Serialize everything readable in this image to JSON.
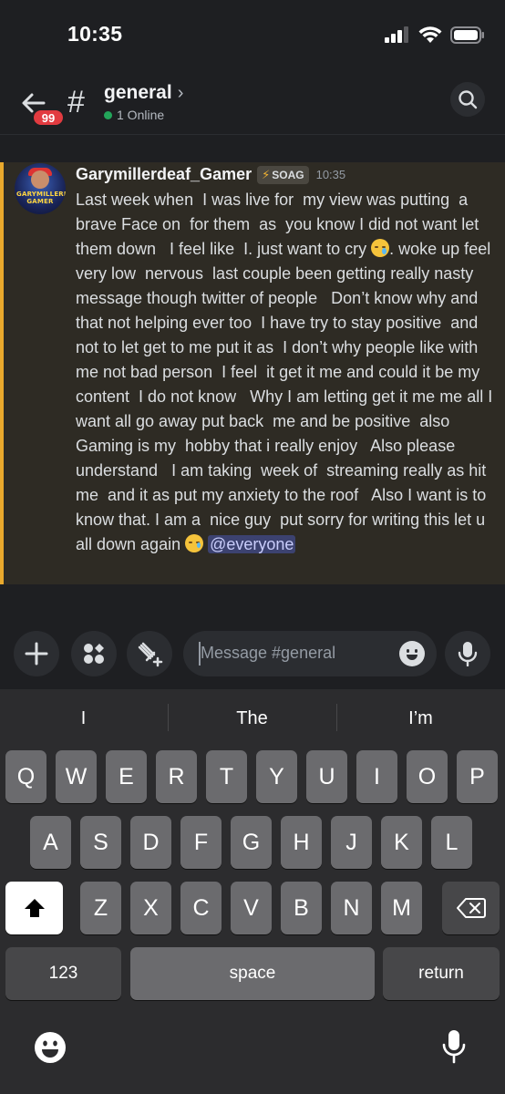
{
  "status_bar": {
    "time": "10:35"
  },
  "header": {
    "notification_count": "99",
    "channel_name": "general",
    "channel_chevron": "›",
    "online_text": "1 Online"
  },
  "message": {
    "avatar_text": "GARYMILLERDEAF GAMER",
    "username": "Garymillerdeaf_Gamer",
    "role_tag": "SOAG",
    "timestamp": "10:35",
    "text_main": "Last week when  I was live for  my view was putting  a  brave Face on  for them  as  you know I did not want let  them down   I feel like  I. just want to cry ",
    "text_mid": ". woke up feel very low  nervous  last couple been getting really nasty message though twitter of people   Don’t know why and that not helping ever too  I have try to stay positive  and not to let get to me put it as  I don’t why people like with me not bad person  I feel  it get it me and could it be my content  I do not know   Why I am letting get it me me all I want all go away put back  me and be positive  also Gaming is my  hobby that i really enjoy   Also please understand   I am taking  week of  streaming really as hit me  and it as put my anxiety to the roof   Also I want is to know that. I am a  nice guy  put sorry for writing this let u all down again ",
    "mention": "@everyone"
  },
  "composer": {
    "placeholder": "Message #general"
  },
  "keyboard": {
    "suggestions": [
      "I",
      "The",
      "I’m"
    ],
    "row1": [
      "Q",
      "W",
      "E",
      "R",
      "T",
      "Y",
      "U",
      "I",
      "O",
      "P"
    ],
    "row2": [
      "A",
      "S",
      "D",
      "F",
      "G",
      "H",
      "J",
      "K",
      "L"
    ],
    "row3": [
      "Z",
      "X",
      "C",
      "V",
      "B",
      "N",
      "M"
    ],
    "numbers_key": "123",
    "space_key": "space",
    "return_key": "return"
  },
  "colors": {
    "background": "#1e1f22",
    "highlight_bg": "#2e2b24",
    "highlight_border": "#e9a92d",
    "online": "#23a55a",
    "badge": "#e23b40",
    "mention_bg": "#3c4270"
  }
}
